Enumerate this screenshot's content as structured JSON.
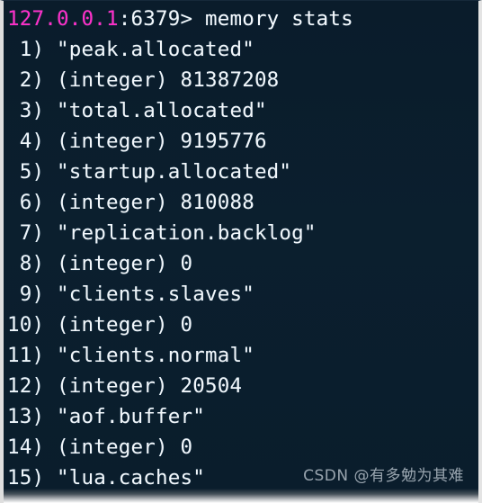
{
  "terminal": {
    "app": "redis-cli",
    "background_color": "#0b1e2d",
    "foreground_color": "#f2f7fb",
    "prompt_accent_color": "#ff2ec8",
    "prompt": {
      "host": "127.0.0.1",
      "port_and_caret": ":6379>",
      "command": "memory stats",
      "full_line": "127.0.0.1:6379> memory stats"
    },
    "output_lines": [
      {
        "index": " 1)",
        "text": "\"peak.allocated\"",
        "kind": "string"
      },
      {
        "index": " 2)",
        "text": "(integer) 81387208",
        "kind": "integer"
      },
      {
        "index": " 3)",
        "text": "\"total.allocated\"",
        "kind": "string"
      },
      {
        "index": " 4)",
        "text": "(integer) 9195776",
        "kind": "integer"
      },
      {
        "index": " 5)",
        "text": "\"startup.allocated\"",
        "kind": "string"
      },
      {
        "index": " 6)",
        "text": "(integer) 810088",
        "kind": "integer"
      },
      {
        "index": " 7)",
        "text": "\"replication.backlog\"",
        "kind": "string"
      },
      {
        "index": " 8)",
        "text": "(integer) 0",
        "kind": "integer"
      },
      {
        "index": " 9)",
        "text": "\"clients.slaves\"",
        "kind": "string"
      },
      {
        "index": "10)",
        "text": "(integer) 0",
        "kind": "integer"
      },
      {
        "index": "11)",
        "text": "\"clients.normal\"",
        "kind": "string"
      },
      {
        "index": "12)",
        "text": "(integer) 20504",
        "kind": "integer"
      },
      {
        "index": "13)",
        "text": "\"aof.buffer\"",
        "kind": "string"
      },
      {
        "index": "14)",
        "text": "(integer) 0",
        "kind": "integer"
      },
      {
        "index": "15)",
        "text": "\"lua.caches\"",
        "kind": "string"
      }
    ]
  },
  "watermark": {
    "text": "CSDN @有多勉为其难"
  }
}
